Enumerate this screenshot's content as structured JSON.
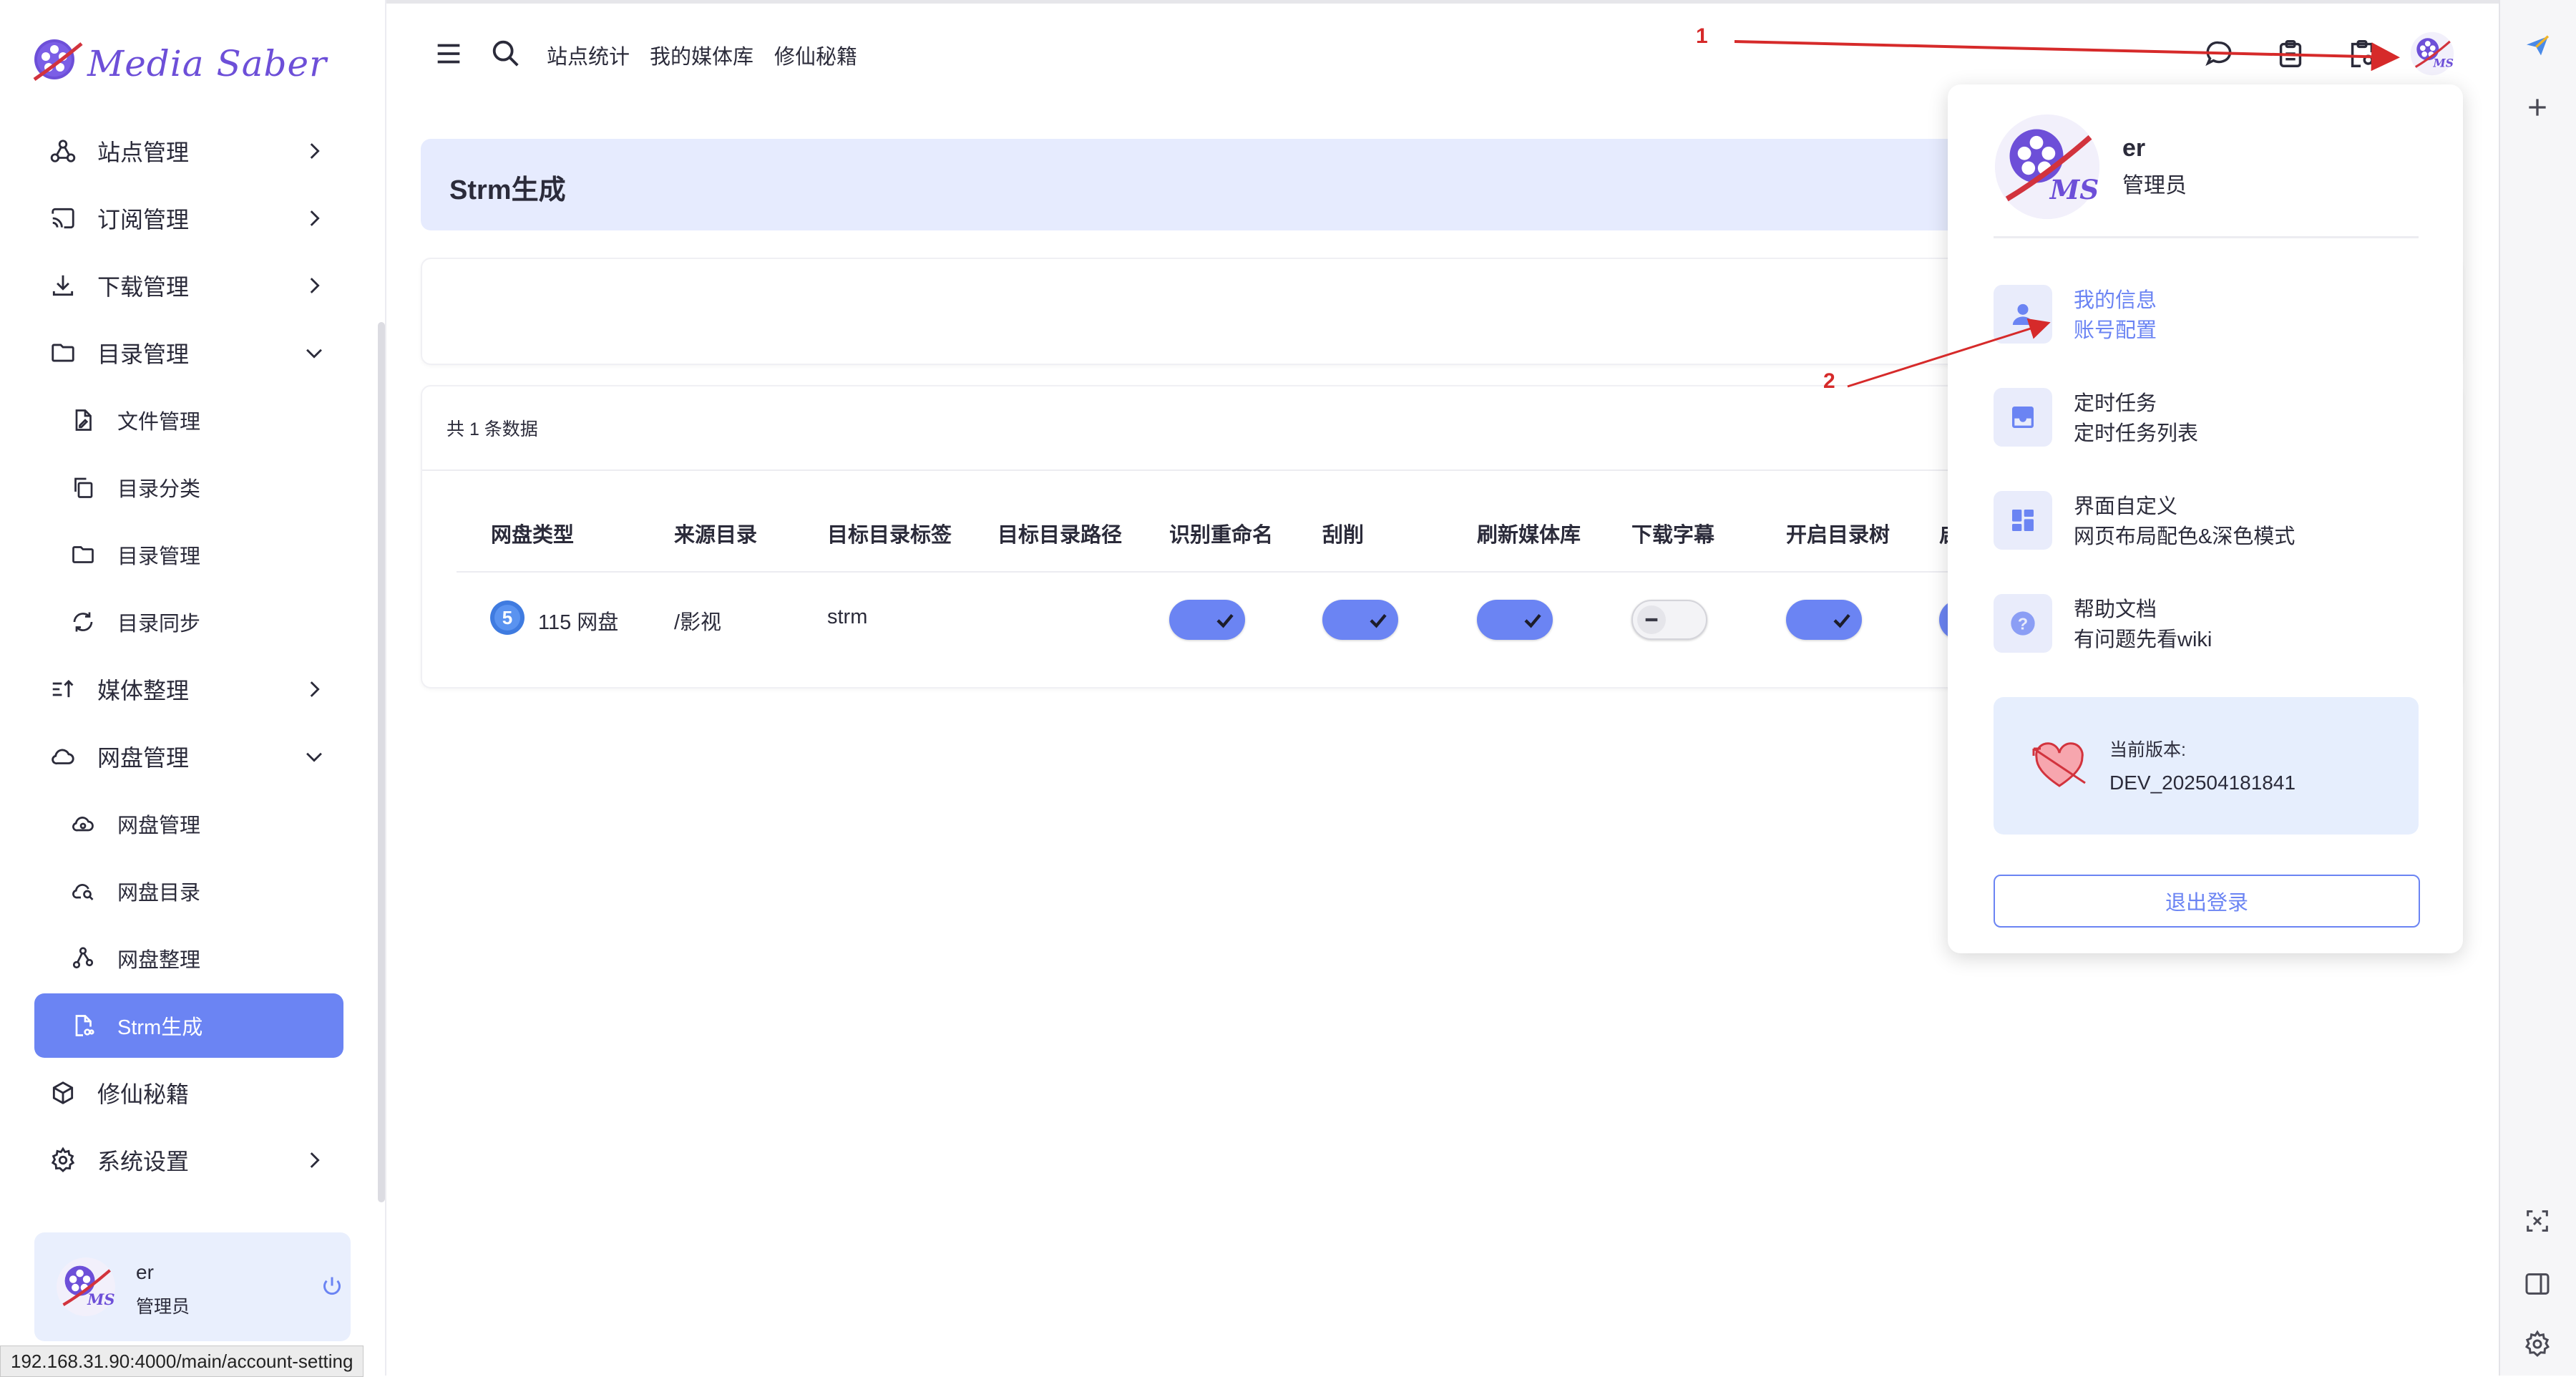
{
  "app": {
    "logo_text": "Media Saber"
  },
  "sidebar": {
    "items": [
      {
        "label": "站点管理"
      },
      {
        "label": "订阅管理"
      },
      {
        "label": "下载管理"
      },
      {
        "label": "目录管理",
        "children": [
          {
            "label": "文件管理"
          },
          {
            "label": "目录分类"
          },
          {
            "label": "目录管理"
          },
          {
            "label": "目录同步"
          }
        ]
      },
      {
        "label": "媒体整理"
      },
      {
        "label": "网盘管理",
        "children": [
          {
            "label": "网盘管理"
          },
          {
            "label": "网盘目录"
          },
          {
            "label": "网盘整理"
          },
          {
            "label": "Strm生成",
            "active": true
          }
        ]
      },
      {
        "label": "修仙秘籍"
      },
      {
        "label": "系统设置"
      }
    ],
    "user": {
      "name": "er",
      "role": "管理员"
    }
  },
  "topbar": {
    "links": [
      "站点统计",
      "我的媒体库",
      "修仙秘籍"
    ]
  },
  "annotations": {
    "n1": "1",
    "n2": "2"
  },
  "page": {
    "title": "Strm生成",
    "count_text": "共 1 条数据",
    "columns": [
      "网盘类型",
      "来源目录",
      "目标目录标签",
      "目标目录路径",
      "识别重命名",
      "刮削",
      "刷新媒体库",
      "下载字幕",
      "开启目录树",
      "启"
    ],
    "rows": [
      {
        "pan_type": "115 网盘",
        "source_dir": "/影视",
        "target_tag": "strm",
        "target_path": "",
        "rename": true,
        "scrape": true,
        "refresh_library": true,
        "download_subtitle": false,
        "dir_tree": true,
        "partial": true
      }
    ]
  },
  "dropdown": {
    "name": "er",
    "role": "管理员",
    "items": [
      {
        "title": "我的信息",
        "subtitle": "账号配置",
        "icon": "person-icon",
        "highlighted": true
      },
      {
        "title": "定时任务",
        "subtitle": "定时任务列表",
        "icon": "inbox-icon"
      },
      {
        "title": "界面自定义",
        "subtitle": "网页布局配色&深色模式",
        "icon": "layout-icon"
      },
      {
        "title": "帮助文档",
        "subtitle": "有问题先看wiki",
        "icon": "help-icon"
      }
    ],
    "version_label": "当前版本:",
    "version_value": "DEV_202504181841",
    "logout_label": "退出登录"
  },
  "status_url": "192.168.31.90:4000/main/account-setting",
  "colors": {
    "accent": "#6b84f3",
    "header_bg": "#e6ebfe",
    "annotation_red": "#d62a2a"
  }
}
